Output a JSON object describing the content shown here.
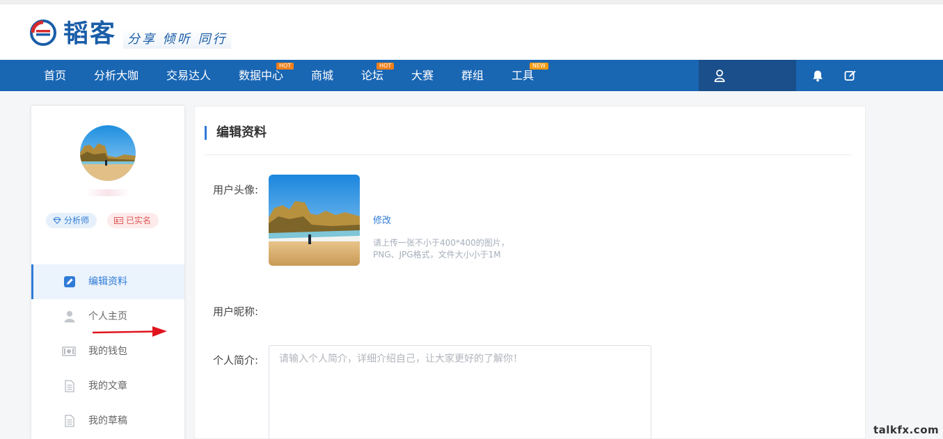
{
  "brand": {
    "name": "韬客",
    "slogan": "分享 倾听 同行",
    "colors": {
      "primary": "#1966b3",
      "accent": "#2f7bd6",
      "hot": "#ef7f1a"
    }
  },
  "nav": {
    "items": [
      {
        "label": "首页",
        "badge": ""
      },
      {
        "label": "分析大咖",
        "badge": ""
      },
      {
        "label": "交易达人",
        "badge": ""
      },
      {
        "label": "数据中心",
        "badge": "HOT"
      },
      {
        "label": "商城",
        "badge": ""
      },
      {
        "label": "论坛",
        "badge": "HOT"
      },
      {
        "label": "大赛",
        "badge": ""
      },
      {
        "label": "群组",
        "badge": ""
      },
      {
        "label": "工具",
        "badge": "NEW"
      }
    ],
    "icons": {
      "user": "user-icon",
      "bell": "bell-icon",
      "edit": "edit-icon"
    }
  },
  "sidebar": {
    "tags": {
      "analyst": "分析师",
      "verified": "已实名"
    },
    "menu": [
      {
        "label": "编辑资料",
        "icon": "edit-square-icon",
        "active": true
      },
      {
        "label": "个人主页",
        "icon": "person-icon",
        "active": false
      },
      {
        "label": "我的钱包",
        "icon": "wallet-icon",
        "active": false
      },
      {
        "label": "我的文章",
        "icon": "document-icon",
        "active": false
      },
      {
        "label": "我的草稿",
        "icon": "draft-icon",
        "active": false
      }
    ]
  },
  "main": {
    "title": "编辑资料",
    "avatar_label": "用户头像:",
    "modify_label": "修改",
    "hint_line1": "请上传一张不小于400*400的图片，",
    "hint_line2": "PNG、JPG格式，文件大小小于1M",
    "nickname_label": "用户昵称:",
    "nickname_value": "",
    "intro_label": "个人简介:",
    "intro_placeholder": "请输入个人简介，详细介绍自己，让大家更好的了解你！"
  },
  "watermark": "talkfx.com"
}
